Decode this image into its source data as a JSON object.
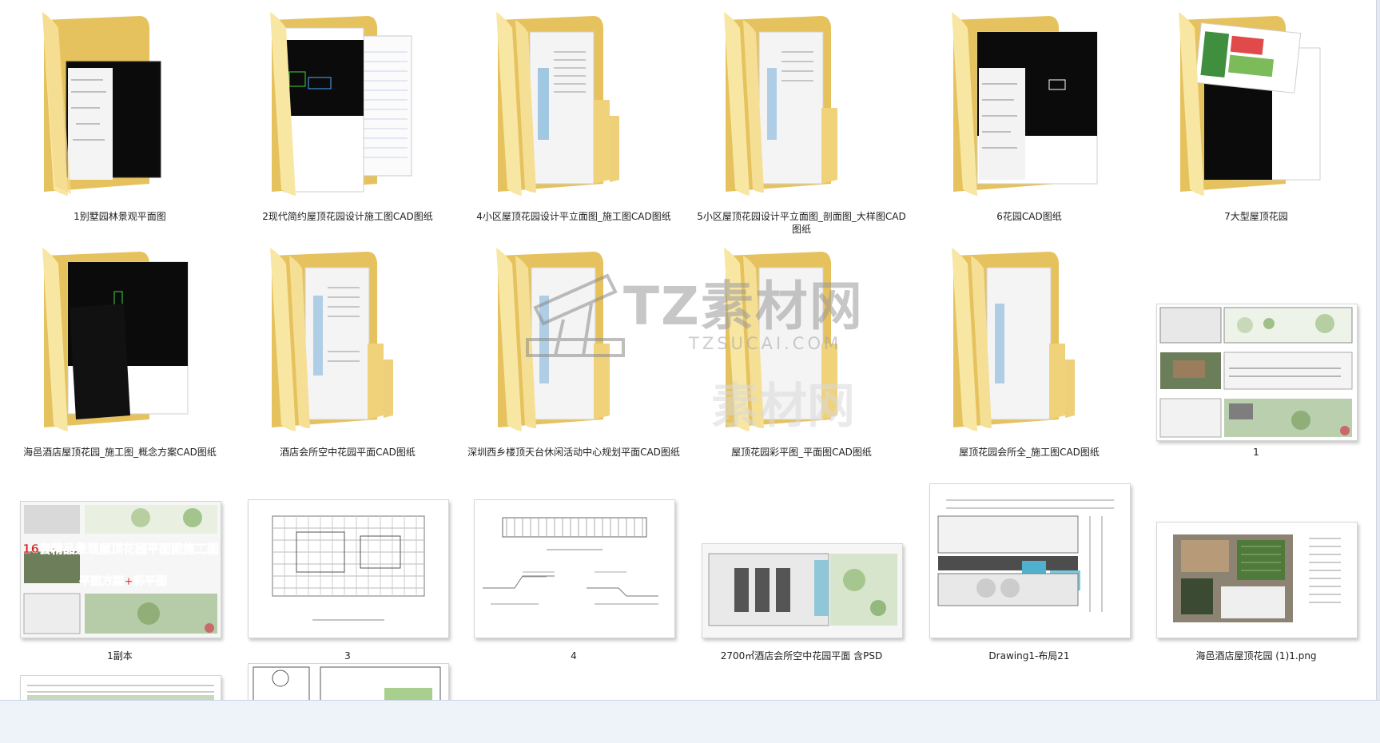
{
  "items": [
    {
      "label": "1别墅园林景观平面图"
    },
    {
      "label": "2现代简约屋顶花园设计施工图CAD图纸"
    },
    {
      "label": "4小区屋顶花园设计平立面图_施工图CAD图纸"
    },
    {
      "label": "5小区屋顶花园设计平立面图_剖面图_大样图CAD图纸"
    },
    {
      "label": "6花园CAD图纸"
    },
    {
      "label": "7大型屋顶花园"
    },
    {
      "label": "海邑酒店屋顶花园_施工图_概念方案CAD图纸"
    },
    {
      "label": "酒店会所空中花园平面CAD图纸"
    },
    {
      "label": "深圳西乡楼顶天台休闲活动中心规划平面CAD图纸"
    },
    {
      "label": "屋顶花园彩平图_平面图CAD图纸"
    },
    {
      "label": "屋顶花园会所全_施工图CAD图纸"
    },
    {
      "label": "1"
    },
    {
      "label": "1副本"
    },
    {
      "label": "3"
    },
    {
      "label": "4"
    },
    {
      "label": "2700㎡酒店会所空中花园平面 含PSD"
    },
    {
      "label": "Drawing1-布局21"
    },
    {
      "label": "海邑酒店屋顶花园 (1)1.png"
    }
  ],
  "thumb_text": {
    "banner_line1": "16套精品景观屋顶花园平面图施工图",
    "banner_line2": "平面方案+彩平图"
  },
  "watermark": {
    "title": "TZ素材网",
    "subtitle": "TZSUCAI.COM",
    "ghost": "素材网"
  },
  "colors": {
    "folder_front": "#f6dc8a",
    "folder_back": "#e9c561",
    "cad_black": "#0a0a0a",
    "banner_red": "#d42020",
    "selection_bg": "#eef2f9"
  }
}
